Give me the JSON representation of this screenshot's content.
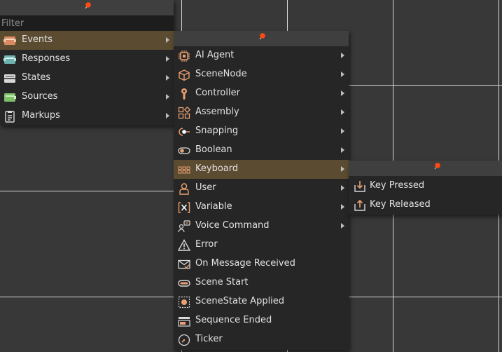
{
  "filter": {
    "placeholder": "Filter",
    "value": ""
  },
  "menu_main": {
    "items": [
      {
        "label": "Events",
        "icon": "events-icon",
        "submenu": true,
        "highlighted": true
      },
      {
        "label": "Responses",
        "icon": "responses-icon",
        "submenu": true
      },
      {
        "label": "States",
        "icon": "states-icon",
        "submenu": true
      },
      {
        "label": "Sources",
        "icon": "sources-icon",
        "submenu": true
      },
      {
        "label": "Markups",
        "icon": "markups-icon",
        "submenu": true
      }
    ]
  },
  "menu_events": {
    "items": [
      {
        "label": "AI Agent",
        "icon": "ai-agent-icon",
        "submenu": true
      },
      {
        "label": "SceneNode",
        "icon": "scenenode-icon",
        "submenu": true
      },
      {
        "label": "Controller",
        "icon": "controller-icon",
        "submenu": true
      },
      {
        "label": "Assembly",
        "icon": "assembly-icon",
        "submenu": true
      },
      {
        "label": "Snapping",
        "icon": "snapping-icon",
        "submenu": true
      },
      {
        "label": "Boolean",
        "icon": "boolean-icon",
        "submenu": true
      },
      {
        "label": "Keyboard",
        "icon": "keyboard-icon",
        "submenu": true,
        "highlighted": true
      },
      {
        "label": "User",
        "icon": "user-icon",
        "submenu": true
      },
      {
        "label": "Variable",
        "icon": "variable-icon",
        "submenu": true
      },
      {
        "label": "Voice Command",
        "icon": "voice-command-icon",
        "submenu": true
      },
      {
        "label": "Error",
        "icon": "error-icon",
        "submenu": false
      },
      {
        "label": "On Message Received",
        "icon": "message-icon",
        "submenu": false
      },
      {
        "label": "Scene Start",
        "icon": "scene-start-icon",
        "submenu": false
      },
      {
        "label": "SceneState Applied",
        "icon": "scenestate-icon",
        "submenu": false
      },
      {
        "label": "Sequence Ended",
        "icon": "sequence-icon",
        "submenu": false
      },
      {
        "label": "Ticker",
        "icon": "ticker-icon",
        "submenu": false
      }
    ]
  },
  "menu_keyboard": {
    "items": [
      {
        "label": "Key Pressed",
        "icon": "key-pressed-icon",
        "submenu": false
      },
      {
        "label": "Key Released",
        "icon": "key-released-icon",
        "submenu": false
      }
    ]
  },
  "colors": {
    "background": "#383838",
    "grid_line": "#dcdcdc",
    "menu_bg": "#262626",
    "menu_header": "#3f3f3f",
    "highlight": "#5b4b30",
    "accent": "#e8a070",
    "pin": "#ff4a12"
  }
}
